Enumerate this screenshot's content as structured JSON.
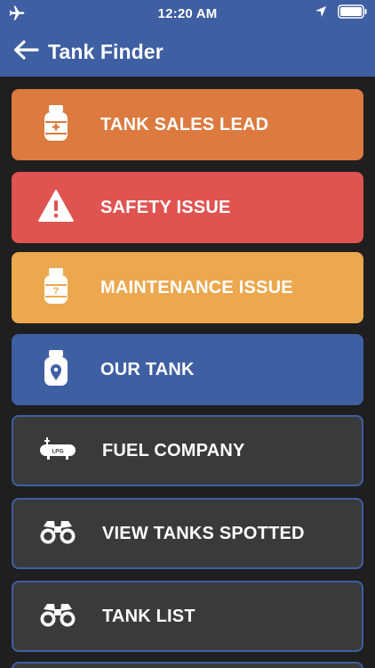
{
  "status_bar": {
    "time": "12:20 AM"
  },
  "nav": {
    "title": "Tank Finder"
  },
  "menu": {
    "items": [
      {
        "label": "TANK SALES LEAD",
        "icon": "propane-tank-plus-icon",
        "color": "#dc7a40"
      },
      {
        "label": "SAFETY ISSUE",
        "icon": "warning-triangle-icon",
        "color": "#df5350"
      },
      {
        "label": "MAINTENANCE ISSUE",
        "icon": "propane-tank-question-icon",
        "color": "#eba84e"
      },
      {
        "label": "OUR TANK",
        "icon": "propane-tank-location-icon",
        "color": "#3f5fa3"
      },
      {
        "label": "FUEL COMPANY",
        "icon": "lpg-tank-icon",
        "color": "#3a3a3a"
      },
      {
        "label": "VIEW TANKS SPOTTED",
        "icon": "binoculars-icon",
        "color": "#3a3a3a"
      },
      {
        "label": "TANK LIST",
        "icon": "binoculars-icon",
        "color": "#3a3a3a"
      }
    ]
  }
}
